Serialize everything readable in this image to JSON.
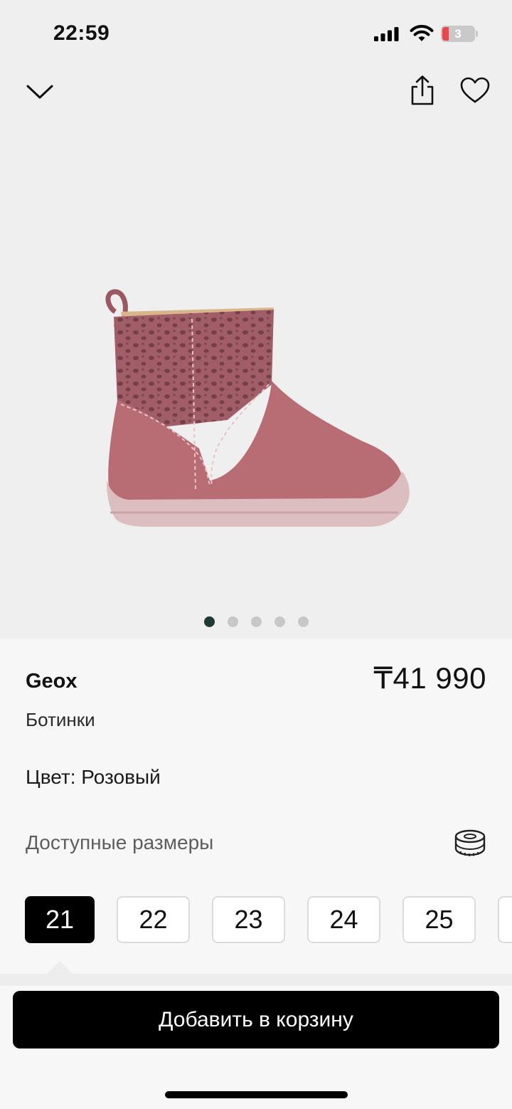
{
  "status_bar": {
    "time": "22:59",
    "battery_level": "3",
    "battery_color": "#e5484d"
  },
  "top_bar": {
    "collapse_icon": "chevron-down-icon",
    "share_icon": "share-icon",
    "favorite_icon": "heart-icon"
  },
  "gallery": {
    "image": "pink-suede-baby-boot-image",
    "total_images": 5,
    "active_index": 0
  },
  "product": {
    "brand": "Geox",
    "price": "₸41 990",
    "type": "Ботинки",
    "color_line": "Цвет: Розовый"
  },
  "sizes": {
    "title": "Доступные размеры",
    "guide_icon": "measuring-tape-icon",
    "options": [
      "21",
      "22",
      "23",
      "24",
      "25"
    ],
    "selected": "21"
  },
  "cart": {
    "label": "Добавить в корзину"
  },
  "colors": {
    "accent": "#000000",
    "active_dot": "#1e3b34",
    "hero_bg": "#efefef"
  }
}
